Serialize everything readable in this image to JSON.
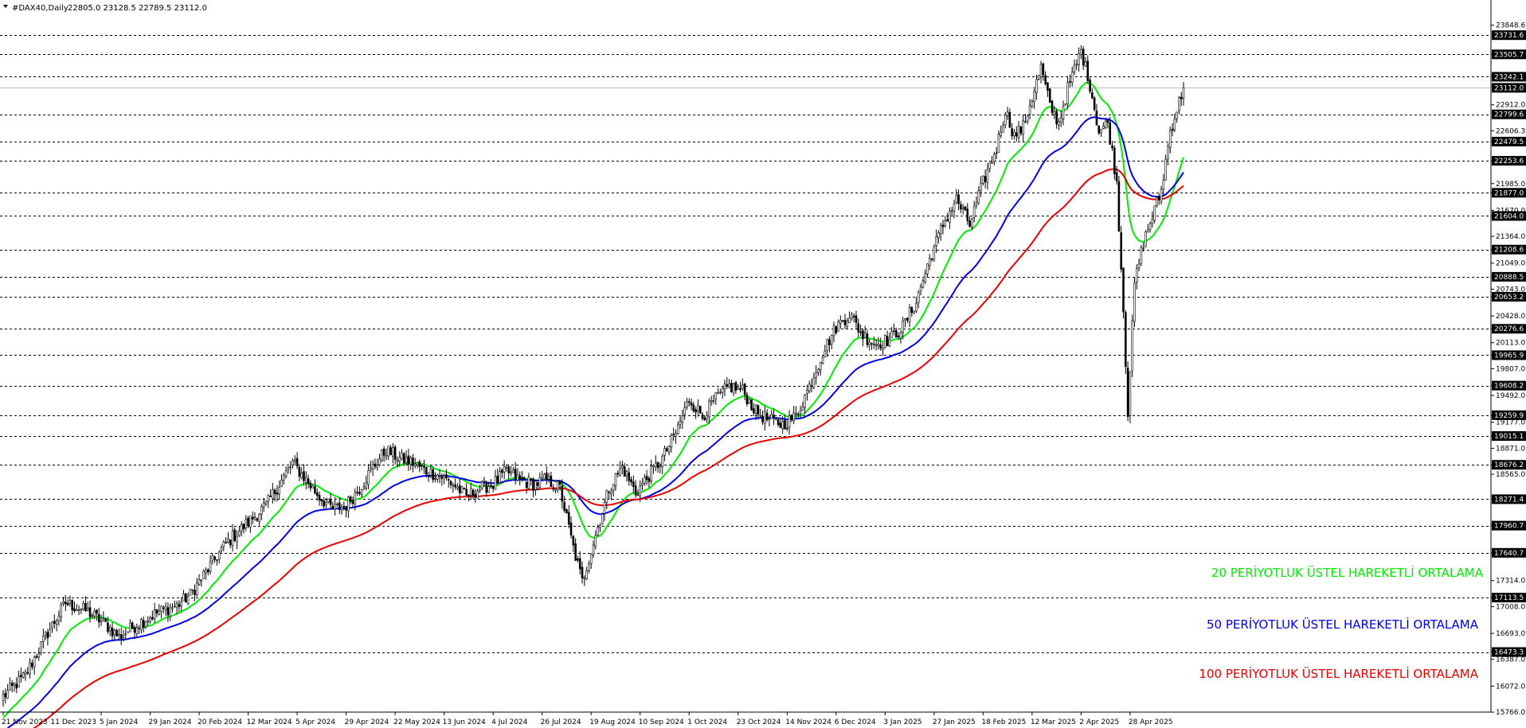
{
  "header": {
    "menu_icon": "triangle-down-icon",
    "symbol": "#DAX40,Daily",
    "ohlc": "22805.0 23128.5 22789.5 23112.0"
  },
  "chart_data": {
    "type": "candlestick",
    "title": "#DAX40,Daily",
    "ylim": [
      15766.6,
      23958
    ],
    "y_ticks": [
      "23848.6",
      "23505.7",
      "23242.1",
      "22912.0",
      "22606.3",
      "22479.5",
      "22253.6",
      "21985.0",
      "21877.0",
      "21670.0",
      "21604.0",
      "21364.0",
      "21208.6",
      "21049.0",
      "20888.5",
      "20743.0",
      "20653.2",
      "20428.0",
      "20276.6",
      "20113.0",
      "19965.9",
      "19807.0",
      "19608.2",
      "19492.0",
      "19259.9",
      "19177.0",
      "19015.1",
      "18871.0",
      "18676.2",
      "18565.0",
      "18271.4",
      "17960.7",
      "17640.7",
      "17314.0",
      "17113.5",
      "17008.0",
      "16693.0",
      "16473.3",
      "16387.0",
      "16072.0",
      "15766.0"
    ],
    "levels": [
      "23731.6",
      "23505.7",
      "23242.1",
      "23112.0",
      "22799.6",
      "22479.5",
      "22253.6",
      "21877.0",
      "21604.0",
      "21208.6",
      "20888.5",
      "20653.2",
      "20276.6",
      "19965.9",
      "19608.2",
      "19259.9",
      "19015.1",
      "18676.2",
      "18271.4",
      "17960.7",
      "17640.7",
      "17113.5",
      "16473.3"
    ],
    "current_price": "23112.0",
    "x_labels": [
      "21 Nov 2023",
      "11 Dec 2023",
      "5 Jan 2024",
      "29 Jan 2024",
      "20 Feb 2024",
      "12 Mar 2024",
      "5 Apr 2024",
      "29 Apr 2024",
      "22 May 2024",
      "13 Jun 2024",
      "4 Jul 2024",
      "26 Jul 2024",
      "19 Aug 2024",
      "10 Sep 2024",
      "1 Oct 2024",
      "23 Oct 2024",
      "14 Nov 2024",
      "6 Dec 2024",
      "3 Jan 2025",
      "27 Jan 2025",
      "18 Feb 2025",
      "12 Mar 2025",
      "2 Apr 2025",
      "28 Apr 2025"
    ],
    "anchors": [
      [
        0,
        15950
      ],
      [
        10,
        16200
      ],
      [
        20,
        16700
      ],
      [
        28,
        17050
      ],
      [
        38,
        16950
      ],
      [
        46,
        16800
      ],
      [
        52,
        16650
      ],
      [
        60,
        16800
      ],
      [
        70,
        16950
      ],
      [
        78,
        17020
      ],
      [
        84,
        17150
      ],
      [
        92,
        17450
      ],
      [
        100,
        17750
      ],
      [
        110,
        18000
      ],
      [
        118,
        18200
      ],
      [
        124,
        18450
      ],
      [
        130,
        18700
      ],
      [
        136,
        18500
      ],
      [
        142,
        18300
      ],
      [
        148,
        18150
      ],
      [
        154,
        18200
      ],
      [
        160,
        18400
      ],
      [
        166,
        18650
      ],
      [
        172,
        18850
      ],
      [
        178,
        18750
      ],
      [
        184,
        18700
      ],
      [
        190,
        18600
      ],
      [
        196,
        18550
      ],
      [
        202,
        18450
      ],
      [
        208,
        18300
      ],
      [
        214,
        18400
      ],
      [
        220,
        18450
      ],
      [
        226,
        18600
      ],
      [
        232,
        18500
      ],
      [
        238,
        18450
      ],
      [
        244,
        18500
      ],
      [
        250,
        18400
      ],
      [
        256,
        17700
      ],
      [
        260,
        17300
      ],
      [
        266,
        17850
      ],
      [
        272,
        18400
      ],
      [
        278,
        18650
      ],
      [
        284,
        18350
      ],
      [
        290,
        18550
      ],
      [
        296,
        18750
      ],
      [
        302,
        19050
      ],
      [
        308,
        19450
      ],
      [
        314,
        19250
      ],
      [
        320,
        19450
      ],
      [
        326,
        19600
      ],
      [
        332,
        19550
      ],
      [
        338,
        19300
      ],
      [
        344,
        19200
      ],
      [
        350,
        19150
      ],
      [
        356,
        19250
      ],
      [
        362,
        19600
      ],
      [
        368,
        20000
      ],
      [
        374,
        20300
      ],
      [
        380,
        20450
      ],
      [
        386,
        20200
      ],
      [
        392,
        20100
      ],
      [
        398,
        20150
      ],
      [
        404,
        20300
      ],
      [
        410,
        20600
      ],
      [
        416,
        21100
      ],
      [
        422,
        21500
      ],
      [
        428,
        21800
      ],
      [
        434,
        21500
      ],
      [
        440,
        22000
      ],
      [
        446,
        22400
      ],
      [
        450,
        22850
      ],
      [
        454,
        22550
      ],
      [
        458,
        22650
      ],
      [
        462,
        23000
      ],
      [
        466,
        23350
      ],
      [
        470,
        22900
      ],
      [
        474,
        22700
      ],
      [
        478,
        23100
      ],
      [
        484,
        23550
      ],
      [
        488,
        23150
      ],
      [
        492,
        22600
      ],
      [
        496,
        22700
      ],
      [
        500,
        22000
      ],
      [
        503,
        20500
      ],
      [
        505,
        19300
      ],
      [
        508,
        20800
      ],
      [
        512,
        21300
      ],
      [
        516,
        21600
      ],
      [
        520,
        21900
      ],
      [
        524,
        22600
      ],
      [
        530,
        23112
      ]
    ],
    "series": [
      {
        "name": "20 PERİYOTLUK ÜSTEL HAREKETLİ ORTALAMA",
        "period": 20,
        "color": "#00ee00"
      },
      {
        "name": "50  PERİYOTLUK ÜSTEL HAREKETLİ ORTALAMA",
        "period": 50,
        "color": "#0000ee"
      },
      {
        "name": "100 PERİYOTLUK ÜSTEL HAREKETLİ ORTALAMA",
        "period": 100,
        "color": "#ee0000"
      }
    ],
    "grid": false,
    "legend_position": "bottom-right"
  }
}
